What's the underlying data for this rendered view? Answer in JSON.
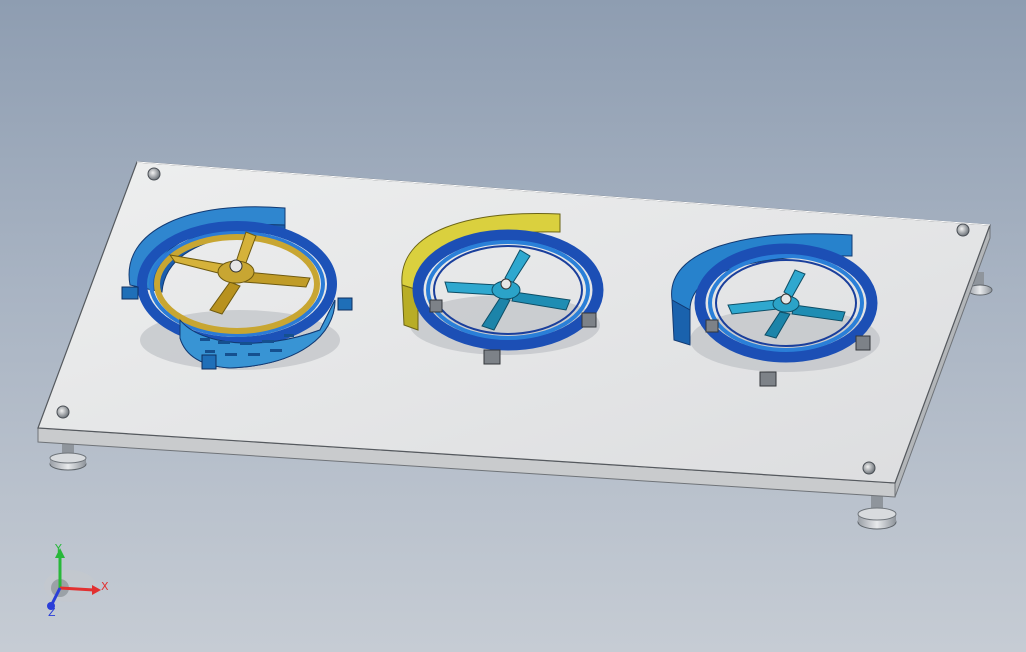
{
  "viewport": {
    "background_top": "#8e9db1",
    "background_bottom": "#c6ccd4"
  },
  "model": {
    "plate_color": "#e6e7e8",
    "fixture_colors": {
      "ring_blue": "#1f7fd0",
      "ring_dark": "#1c4fb5",
      "spider_gold": "#c8a632",
      "spider_teal": "#2ba3c8",
      "cover_yellow": "#d7cc3a"
    }
  },
  "triad": {
    "x_label": "X",
    "y_label": "Y",
    "z_label": "Z",
    "x_color": "#e23030",
    "y_color": "#28b83a",
    "z_color": "#2a3ed8"
  }
}
